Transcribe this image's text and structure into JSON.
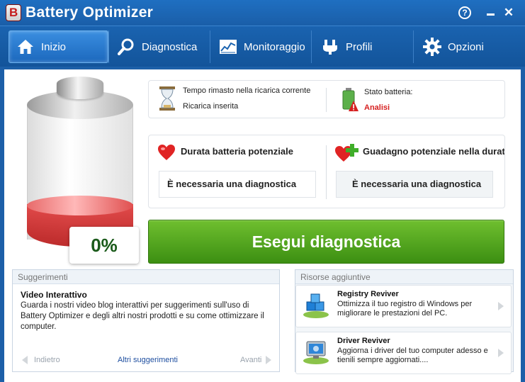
{
  "app": {
    "title": "Battery Optimizer",
    "logo_letter": "B"
  },
  "window_controls": {
    "help": "?",
    "close": "✕"
  },
  "tabs": [
    {
      "label": "Inizio",
      "icon": "home-icon"
    },
    {
      "label": "Diagnostica",
      "icon": "magnifier-icon"
    },
    {
      "label": "Monitoraggio",
      "icon": "chart-icon"
    },
    {
      "label": "Profili",
      "icon": "plug-icon"
    },
    {
      "label": "Opzioni",
      "icon": "gear-icon"
    }
  ],
  "battery": {
    "percent_label": "0%",
    "charge_percent": 0
  },
  "status": {
    "time_label": "Tempo rimasto nella ricarica corrente",
    "charger_label": "Ricarica inserita",
    "battery_state_label": "Stato batteria:",
    "battery_state_value": "Analisi"
  },
  "potential": {
    "duration_title": "Durata batteria potenziale",
    "duration_value": "È necessaria una diagnostica",
    "gain_title": "Guadagno potenziale nella durat",
    "gain_value": "È necessaria una diagnostica"
  },
  "run_button": "Esegui diagnostica",
  "suggestions": {
    "header": "Suggerimenti",
    "title": "Video Interattivo",
    "body": "Guarda i nostri video blog interattivi per suggerimenti sull'uso di Battery Optimizer e degli altri nostri prodotti e su come ottimizzare il computer.",
    "prev": "Indietro",
    "more": "Altri suggerimenti",
    "next": "Avanti"
  },
  "resources": {
    "header": "Risorse aggiuntive",
    "items": [
      {
        "title": "Registry Reviver",
        "desc": "Ottimizza il tuo registro di Windows per migliorare le prestazioni del PC.",
        "icon": "registry-cubes-icon"
      },
      {
        "title": "Driver Reviver",
        "desc": "Aggiorna i driver del tuo computer adesso e tienili sempre aggiornati....",
        "icon": "driver-monitor-icon"
      }
    ]
  },
  "colors": {
    "accent_blue": "#1a63b0",
    "run_green": "#4fa51d",
    "alert_red": "#d62020",
    "percent_green": "#1a5a1a"
  }
}
